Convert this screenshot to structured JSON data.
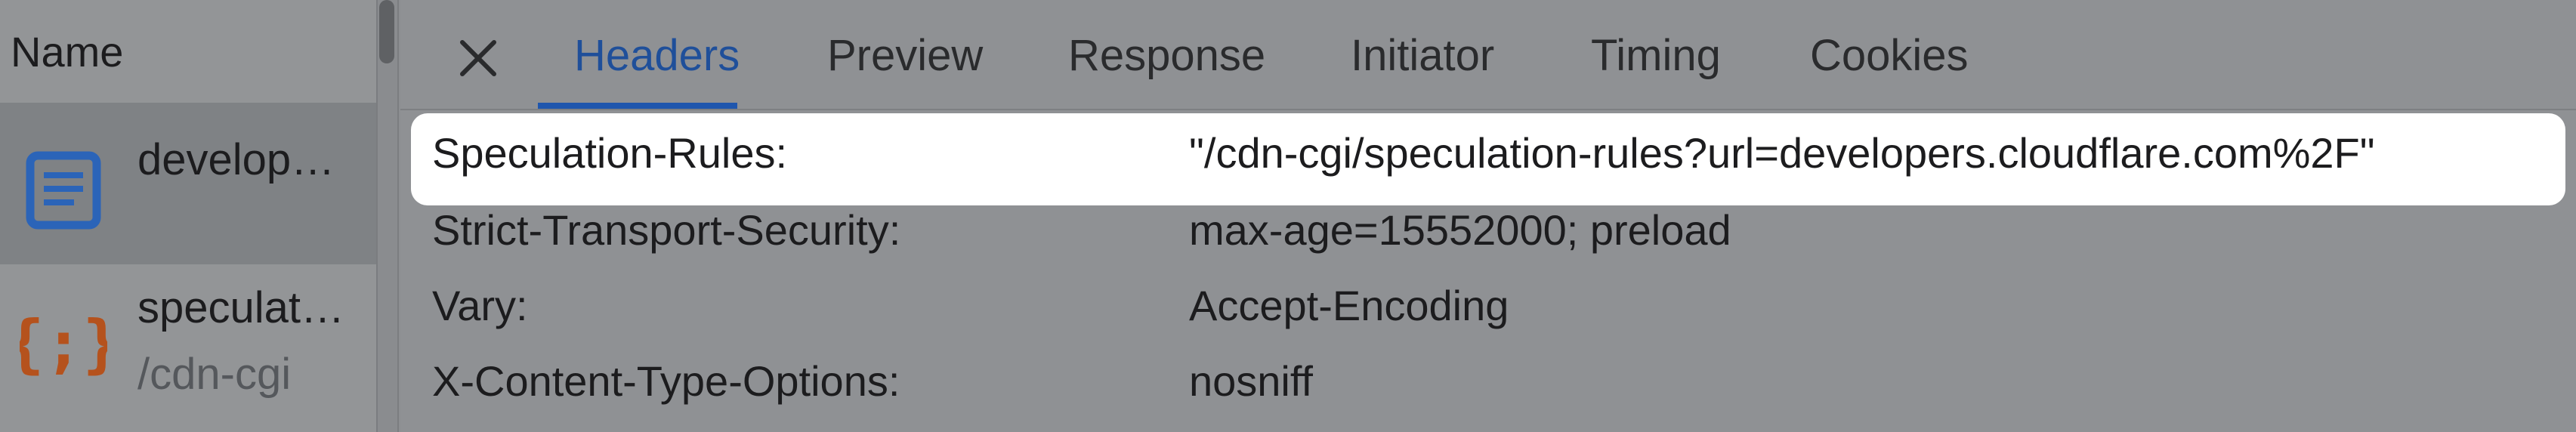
{
  "request_list": {
    "column_header": "Name",
    "items": [
      {
        "name": "develop…",
        "subtitle": "",
        "icon": "document-icon",
        "selected": true
      },
      {
        "name": "speculat…",
        "subtitle": "/cdn-cgi",
        "icon": "json-braces-icon",
        "selected": false
      }
    ]
  },
  "tabs": [
    {
      "label": "Headers",
      "active": true
    },
    {
      "label": "Preview",
      "active": false
    },
    {
      "label": "Response",
      "active": false
    },
    {
      "label": "Initiator",
      "active": false
    },
    {
      "label": "Timing",
      "active": false
    },
    {
      "label": "Cookies",
      "active": false
    }
  ],
  "headers": [
    {
      "key": "Speculation-Rules:",
      "value": "\"/cdn-cgi/speculation-rules?url=developers.cloudflare.com%2F\"",
      "highlighted": true
    },
    {
      "key": "Strict-Transport-Security:",
      "value": "max-age=15552000; preload",
      "highlighted": false
    },
    {
      "key": "Vary:",
      "value": "Accept-Encoding",
      "highlighted": false
    },
    {
      "key": "X-Content-Type-Options:",
      "value": "nosniff",
      "highlighted": false
    }
  ],
  "colors": {
    "accent": "#1f56ad",
    "document_icon": "#2b64b8",
    "json_icon": "#b5521d",
    "overlay": "#8f9194",
    "highlight": "#ffffff"
  }
}
